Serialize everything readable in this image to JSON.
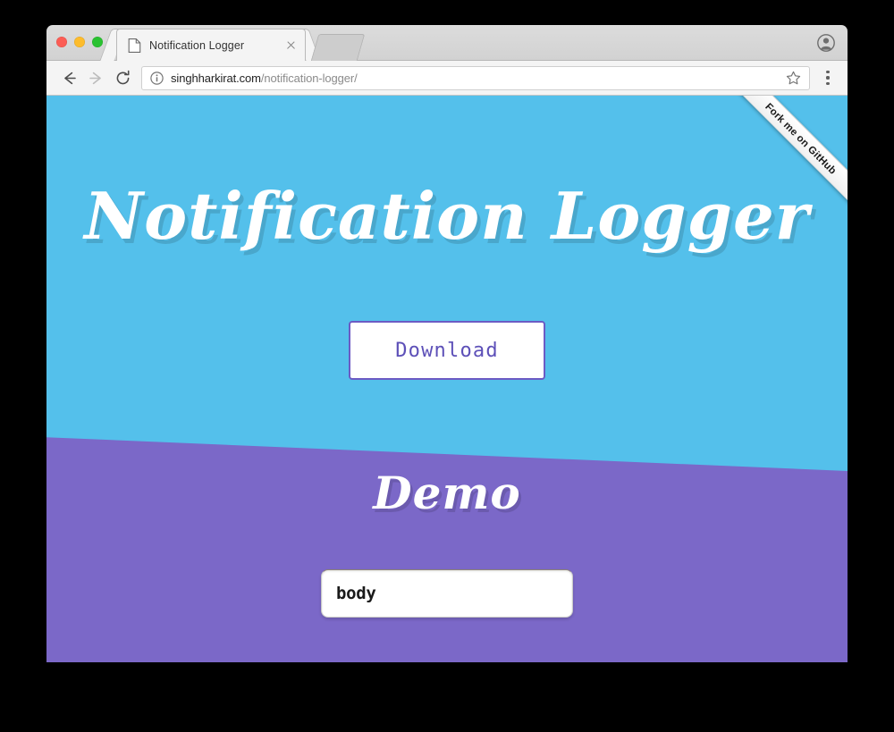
{
  "browser": {
    "traffic_lights": [
      "close",
      "minimize",
      "maximize"
    ],
    "tab": {
      "title": "Notification Logger",
      "favicon": "page-icon",
      "close_label": "×"
    },
    "toolbar": {
      "back_icon": "back-arrow-icon",
      "forward_icon": "forward-arrow-icon",
      "reload_icon": "reload-icon",
      "info_icon": "info-circle-icon",
      "url_domain": "singhharkirat.com",
      "url_path": "/notification-logger/",
      "url_full": "singhharkirat.com/notification-logger/",
      "star_icon": "star-bookmark-icon",
      "menu_icon": "three-dot-menu-icon",
      "profile_icon": "profile-avatar-icon"
    }
  },
  "page": {
    "ribbon": {
      "label": "Fork me on GitHub"
    },
    "hero": {
      "title": "Notification Logger",
      "download_label": "Download",
      "background_color": "#54C0EB"
    },
    "demo": {
      "title": "Demo",
      "input_value": "body",
      "input_placeholder": "body",
      "background_color": "#7B68C8",
      "button_color": "#3E35A8"
    }
  },
  "colors": {
    "hero_blue": "#54C0EB",
    "demo_purple": "#7B68C8",
    "accent_indigo": "#3E35A8",
    "download_text": "#5D50B8"
  }
}
